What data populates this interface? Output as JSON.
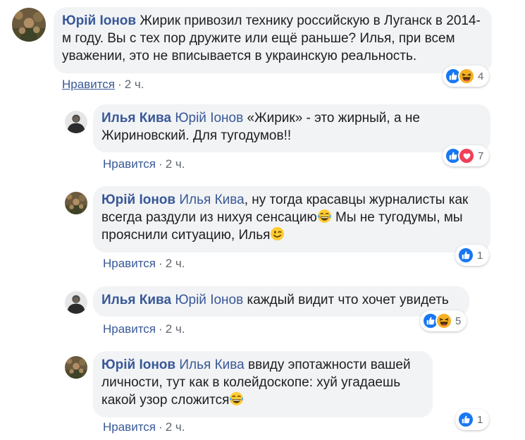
{
  "comments": [
    {
      "author": "Юрій Іонов",
      "text": "Жирик привозил технику российскую в Луганск в 2014-м году. Вы с тех пор дружите или ещё раньше? Илья, при всем уважении, это не вписывается в украинскую реальность.",
      "like_label": "Нравится",
      "time": "2 ч.",
      "reactions": [
        "like",
        "haha"
      ],
      "reaction_count": "4"
    },
    {
      "author": "Илья Кива",
      "mention": "Юрій Іонов",
      "text": "«Жирик» - это жирный, а не Жириновский. Для тугодумов!!",
      "like_label": "Нравится",
      "time": "2 ч.",
      "reactions": [
        "like",
        "love"
      ],
      "reaction_count": "7"
    },
    {
      "author": "Юрій Іонов",
      "mention": "Илья Кива",
      "text_1": ", ну тогда красавцы журналисты как всегда раздули из нихуя сенсацию",
      "text_2": " Мы не тугодумы, мы прояснили ситуацию, Илья",
      "like_label": "Нравится",
      "time": "2 ч.",
      "reactions": [
        "like"
      ],
      "reaction_count": "1"
    },
    {
      "author": "Илья Кива",
      "mention": "Юрій Іонов",
      "text": "каждый видит что хочет увидеть",
      "like_label": "Нравится",
      "time": "2 ч.",
      "reactions": [
        "like",
        "haha"
      ],
      "reaction_count": "5"
    },
    {
      "author": "Юрій Іонов",
      "mention": "Илья Кива",
      "text": "ввиду эпотажности вашей личности, тут как в колейдоскопе: хуй угадаешь какой узор сложится",
      "like_label": "Нравится",
      "time": "2 ч.",
      "reactions": [
        "like"
      ],
      "reaction_count": "1"
    }
  ],
  "separator": "·",
  "icons": {
    "like": "thumbs-up-icon",
    "love": "heart-icon",
    "haha": "laughing-face-icon",
    "tears": "tears-of-joy-emoji",
    "wink": "winking-face-emoji"
  },
  "colors": {
    "author": "#385898",
    "bubble": "#f2f3f5",
    "like": "#1877f2",
    "love": "#f33e58",
    "haha": "#f7b125",
    "meta": "#616770"
  }
}
